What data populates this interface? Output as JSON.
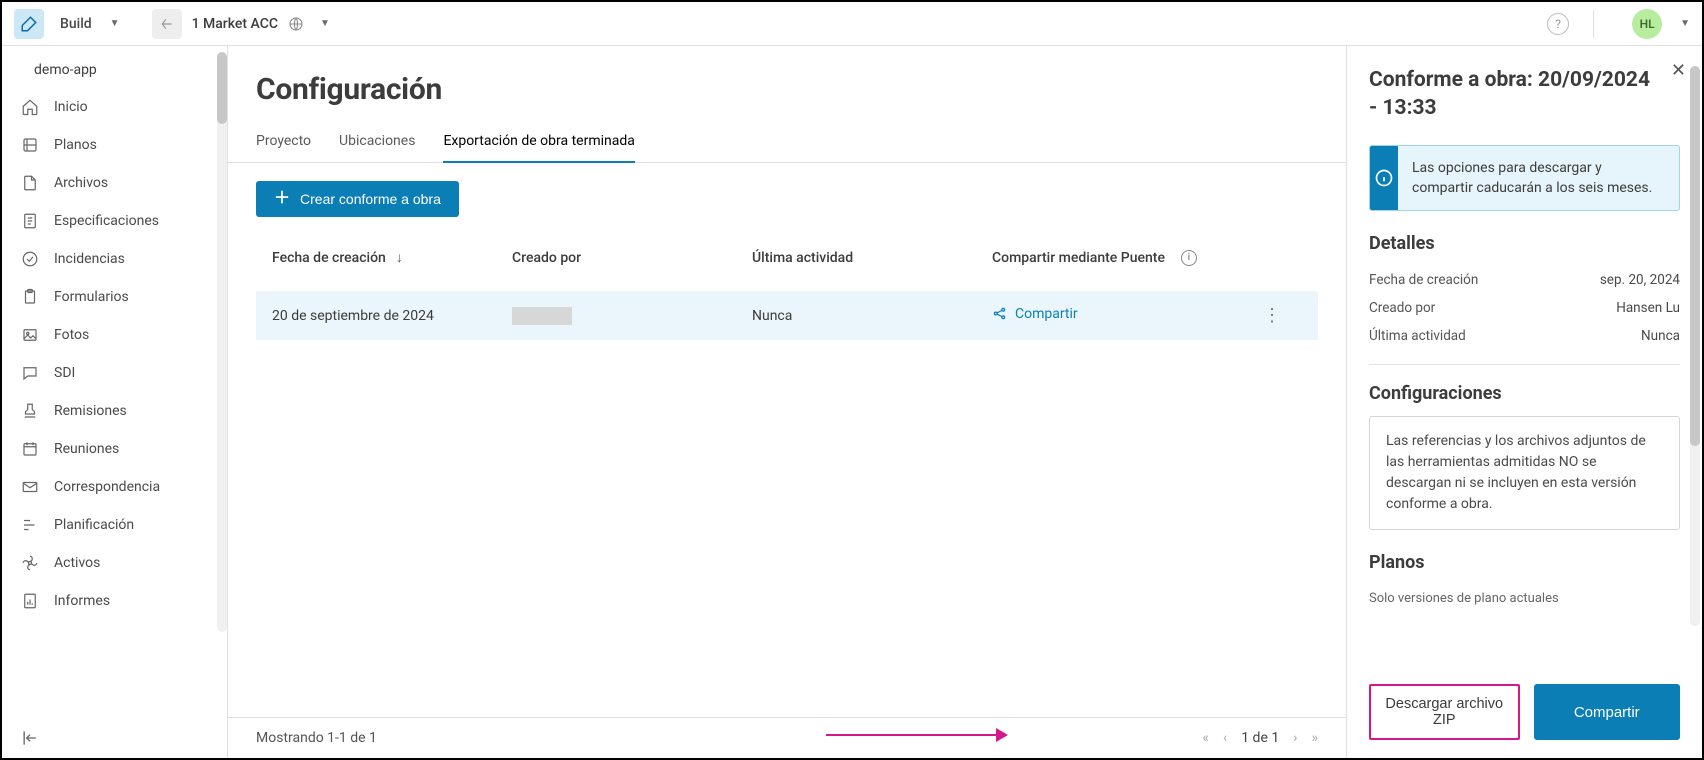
{
  "app": {
    "name": "Build"
  },
  "project": {
    "name": "1 Market ACC"
  },
  "user": {
    "initials": "HL"
  },
  "sidebar": {
    "header": "demo-app",
    "items": [
      {
        "label": "Inicio"
      },
      {
        "label": "Planos"
      },
      {
        "label": "Archivos"
      },
      {
        "label": "Especificaciones"
      },
      {
        "label": "Incidencias"
      },
      {
        "label": "Formularios"
      },
      {
        "label": "Fotos"
      },
      {
        "label": "SDI"
      },
      {
        "label": "Remisiones"
      },
      {
        "label": "Reuniones"
      },
      {
        "label": "Correspondencia"
      },
      {
        "label": "Planificación"
      },
      {
        "label": "Activos"
      },
      {
        "label": "Informes"
      }
    ]
  },
  "page": {
    "title": "Configuración",
    "tabs": [
      {
        "label": "Proyecto"
      },
      {
        "label": "Ubicaciones"
      },
      {
        "label": "Exportación de obra terminada"
      }
    ],
    "create_btn": "Crear conforme a obra"
  },
  "table": {
    "headers": {
      "created": "Fecha de creación",
      "by": "Creado por",
      "last": "Última actividad",
      "share": "Compartir mediante Puente"
    },
    "rows": [
      {
        "created": "20 de septiembre de 2024",
        "last": "Nunca",
        "share": "Compartir"
      }
    ]
  },
  "footer": {
    "showing": "Mostrando 1-1 de 1",
    "page": "1 de 1"
  },
  "panel": {
    "title": "Conforme a obra: 20/09/2024 - 13:33",
    "info": "Las opciones para descargar y compartir caducarán a los seis meses.",
    "details_h": "Detalles",
    "details": {
      "created_k": "Fecha de creación",
      "created_v": "sep. 20, 2024",
      "by_k": "Creado por",
      "by_v": "Hansen Lu",
      "last_k": "Última actividad",
      "last_v": "Nunca"
    },
    "config_h": "Configuraciones",
    "config_note": "Las referencias y los archivos adjuntos de las herramientas admitidas NO se descargan ni se incluyen en esta versión conforme a obra.",
    "plans_h": "Planos",
    "plans_sub": "Solo versiones de plano actuales",
    "download_btn": "Descargar archivo ZIP",
    "share_btn": "Compartir"
  }
}
